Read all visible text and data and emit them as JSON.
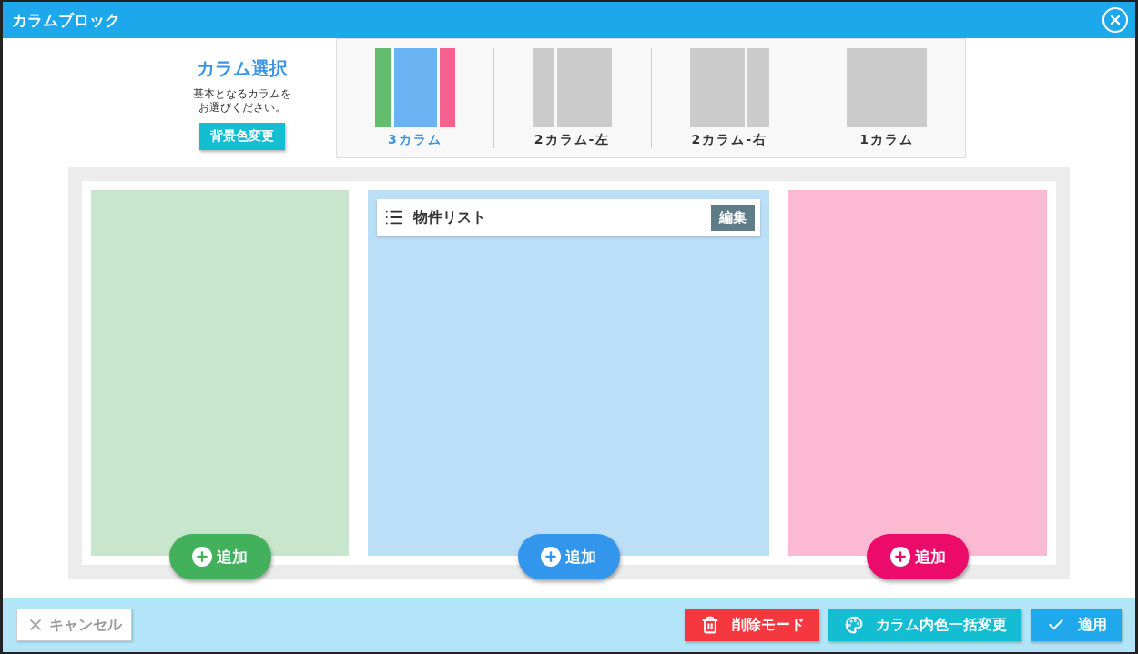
{
  "window": {
    "title": "カラムブロック"
  },
  "column_select": {
    "title": "カラム選択",
    "description": [
      "基本となるカラムを",
      "お選びください。"
    ],
    "bg_button": "背景色変更"
  },
  "layouts": [
    {
      "kind": "three",
      "label": "3カラム",
      "selected": true
    },
    {
      "kind": "two-left",
      "label": "2カラム-左",
      "selected": false
    },
    {
      "kind": "two-right",
      "label": "2カラム-右",
      "selected": false
    },
    {
      "kind": "one",
      "label": "1カラム",
      "selected": false
    }
  ],
  "columns": [
    {
      "color": "#c8e6cc",
      "add_button": {
        "label": "追加",
        "color": "#43b05c"
      }
    },
    {
      "color": "#bcdff8",
      "widgets": [
        {
          "title": "物件リスト",
          "edit_label": "編集"
        }
      ],
      "add_button": {
        "label": "追加",
        "color": "#3196ec"
      }
    },
    {
      "color": "#fbb9d2",
      "add_button": {
        "label": "追加",
        "color": "#ec0a6a"
      }
    }
  ],
  "footer": {
    "cancel": "キャンセル",
    "actions": [
      {
        "kind": "delete",
        "label": "削除モード",
        "color": "#f5383f"
      },
      {
        "kind": "palette",
        "label": "カラム内色一括変更",
        "color": "#13bdd2"
      },
      {
        "kind": "apply",
        "label": "適用",
        "color": "#1fa9ec"
      }
    ]
  }
}
